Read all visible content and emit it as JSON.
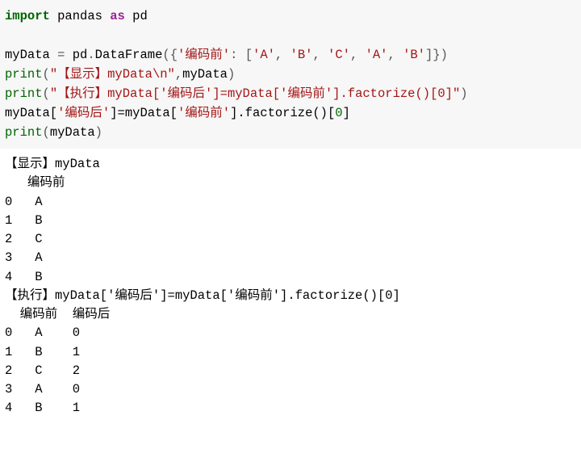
{
  "code": {
    "line1": {
      "import": "import",
      "mod": "pandas",
      "as": "as",
      "alias": "pd"
    },
    "line3": {
      "lhs": "myData",
      "eq": "=",
      "pd": "pd",
      "dot": ".",
      "df": "DataFrame",
      "open": "({",
      "key": "'编码前'",
      "colon": ": [",
      "v1": "'A'",
      "c1": ", ",
      "v2": "'B'",
      "c2": ", ",
      "v3": "'C'",
      "c3": ", ",
      "v4": "'A'",
      "c4": ", ",
      "v5": "'B'",
      "close": "]})"
    },
    "line4": {
      "print": "print",
      "open": "(",
      "arg1": "\"【显示】myData\\n\"",
      "comma": ",",
      "arg2": "myData",
      "close": ")"
    },
    "line5": {
      "print": "print",
      "open": "(",
      "arg": "\"【执行】myData['编码后']=myData['编码前'].factorize()[0]\"",
      "close": ")"
    },
    "line6": {
      "lhs1": "myData[",
      "key1": "'编码后'",
      "mid": "]=myData[",
      "key2": "'编码前'",
      "rest": "].factorize()[",
      "idx": "0",
      "end": "]"
    },
    "line7": {
      "print": "print",
      "open": "(",
      "arg": "myData",
      "close": ")"
    }
  },
  "output": {
    "l1": "【显示】myData",
    "l2": "   编码前",
    "l3": "0   A",
    "l4": "1   B",
    "l5": "2   C",
    "l6": "3   A",
    "l7": "4   B",
    "l8": "【执行】myData['编码后']=myData['编码前'].factorize()[0]",
    "l9": "  编码前  编码后",
    "l10": "0   A    0",
    "l11": "1   B    1",
    "l12": "2   C    2",
    "l13": "3   A    0",
    "l14": "4   B    1"
  }
}
